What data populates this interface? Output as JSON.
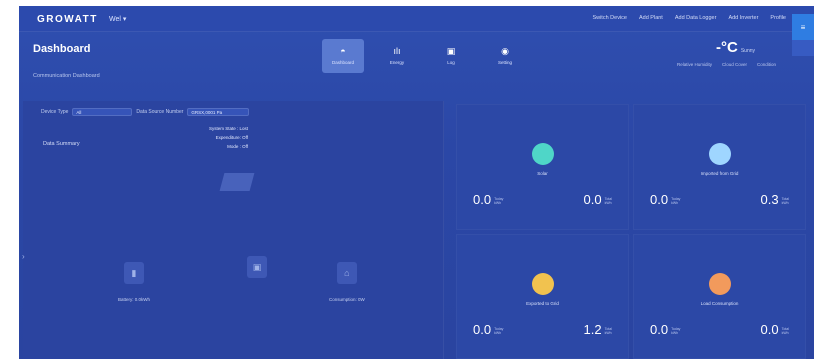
{
  "topbar": {
    "logo": "GROWATT",
    "plant": "Wel ▾",
    "links": [
      "Switch Device",
      "Add Plant",
      "Add Data Logger",
      "Add Inverter",
      "Profile"
    ],
    "side_icon": "≡"
  },
  "header": {
    "title": "Dashboard",
    "subtitle": "Communication Dashboard",
    "tabs": [
      {
        "label": "Dashboard",
        "icon": "◓"
      },
      {
        "label": "Energy",
        "icon": "ılı"
      },
      {
        "label": "Log",
        "icon": "▣"
      },
      {
        "label": "Setting",
        "icon": "◉"
      }
    ],
    "temperature": "-°C",
    "temp_unit": "Sunny",
    "weather": [
      "Relative Humidity",
      "Cloud Cover",
      "Condition"
    ]
  },
  "left_panel": {
    "device_type_label": "Device Type",
    "device_type_value": "All",
    "serial_label": "Data Source Number",
    "serial_value": "GRSX,0001 Pa",
    "system_info": [
      "System State : Lost",
      "Expenditure: Off",
      "Mode : Off"
    ],
    "data_summary": "Data Summary",
    "battery_label": "Battery: 0.0kWh",
    "consumption_label": "Consumption: 0W"
  },
  "cards": [
    {
      "title": "Solar",
      "color": "#4fd6c8",
      "left_value": "0.0",
      "left_unit_a": "Today",
      "left_unit_b": "kWh",
      "right_value": "0.0",
      "right_unit_a": "Total",
      "right_unit_b": "kWh"
    },
    {
      "title": "Imported from Grid",
      "color": "#9fd6ff",
      "left_value": "0.0",
      "left_unit_a": "Today",
      "left_unit_b": "kWh",
      "right_value": "0.3",
      "right_unit_a": "Total",
      "right_unit_b": "kWh"
    },
    {
      "title": "Exported to Grid",
      "color": "#f1c24f",
      "left_value": "0.0",
      "left_unit_a": "Today",
      "left_unit_b": "kWh",
      "right_value": "1.2",
      "right_unit_a": "Total",
      "right_unit_b": "kWh"
    },
    {
      "title": "Load Consumption",
      "color": "#f29a5c",
      "left_value": "0.0",
      "left_unit_a": "Today",
      "left_unit_b": "kWh",
      "right_value": "0.0",
      "right_unit_a": "Total",
      "right_unit_b": "kWh"
    }
  ]
}
